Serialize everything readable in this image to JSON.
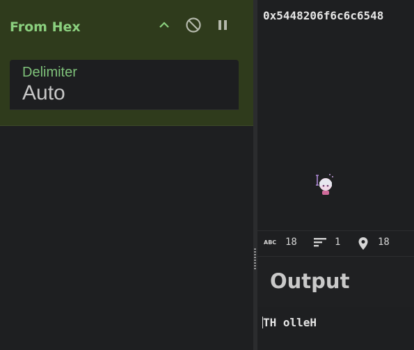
{
  "operation": {
    "title": "From Hex",
    "controls": {
      "collapse_icon": "chevron-up-icon",
      "disable_icon": "disable-icon",
      "pause_icon": "pause-icon"
    },
    "delimiter": {
      "label": "Delimiter",
      "value": "Auto"
    }
  },
  "input": {
    "text": "0x5448206f6c6c6548"
  },
  "status": {
    "length": "18",
    "lines": "1",
    "position": "18",
    "length_icon": "abc-icon",
    "lines_icon": "lines-icon",
    "position_icon": "location-pin-icon"
  },
  "output": {
    "title": "Output",
    "text": "TH olleH"
  },
  "colors": {
    "operation_bg": "#2f3b1c",
    "operation_title": "#8bd07f",
    "delimiter_label": "#7fc27a",
    "page_bg": "#1e1f21"
  }
}
